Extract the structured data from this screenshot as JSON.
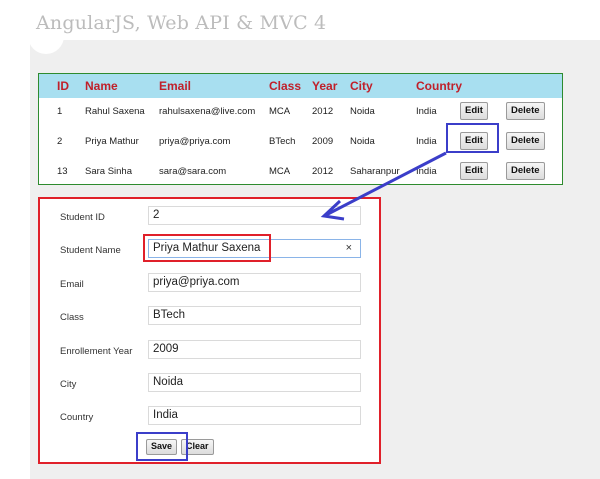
{
  "slide_title": "AngularJS, Web API & MVC 4",
  "table": {
    "headers": [
      "ID",
      "Name",
      "Email",
      "Class",
      "Year",
      "City",
      "Country"
    ],
    "rows": [
      {
        "id": "1",
        "name": "Rahul Saxena",
        "email": "rahulsaxena@live.com",
        "class": "MCA",
        "year": "2012",
        "city": "Noida",
        "country": "India"
      },
      {
        "id": "2",
        "name": "Priya Mathur",
        "email": "priya@priya.com",
        "class": "BTech",
        "year": "2009",
        "city": "Noida",
        "country": "India"
      },
      {
        "id": "13",
        "name": "Sara Sinha",
        "email": "sara@sara.com",
        "class": "MCA",
        "year": "2012",
        "city": "Saharanpur",
        "country": "India"
      }
    ],
    "edit_label": "Edit",
    "delete_label": "Delete"
  },
  "form": {
    "student_id": {
      "label": "Student ID",
      "value": "2"
    },
    "student_name": {
      "label": "Student Name",
      "value": "Priya Mathur Saxena",
      "clear_glyph": "×"
    },
    "email": {
      "label": "Email",
      "value": "priya@priya.com"
    },
    "class": {
      "label": "Class",
      "value": "BTech"
    },
    "enrollment_year": {
      "label": "Enrollement Year",
      "value": "2009"
    },
    "city": {
      "label": "City",
      "value": "Noida"
    },
    "country": {
      "label": "Country",
      "value": "India"
    },
    "save_label": "Save",
    "clear_label": "Clear"
  },
  "colors": {
    "header_bg": "#a8dff0",
    "header_text": "#c0202a",
    "table_border": "#2e8b2e",
    "form_border": "#e0202a",
    "highlight_blue": "#3b3ec9"
  }
}
